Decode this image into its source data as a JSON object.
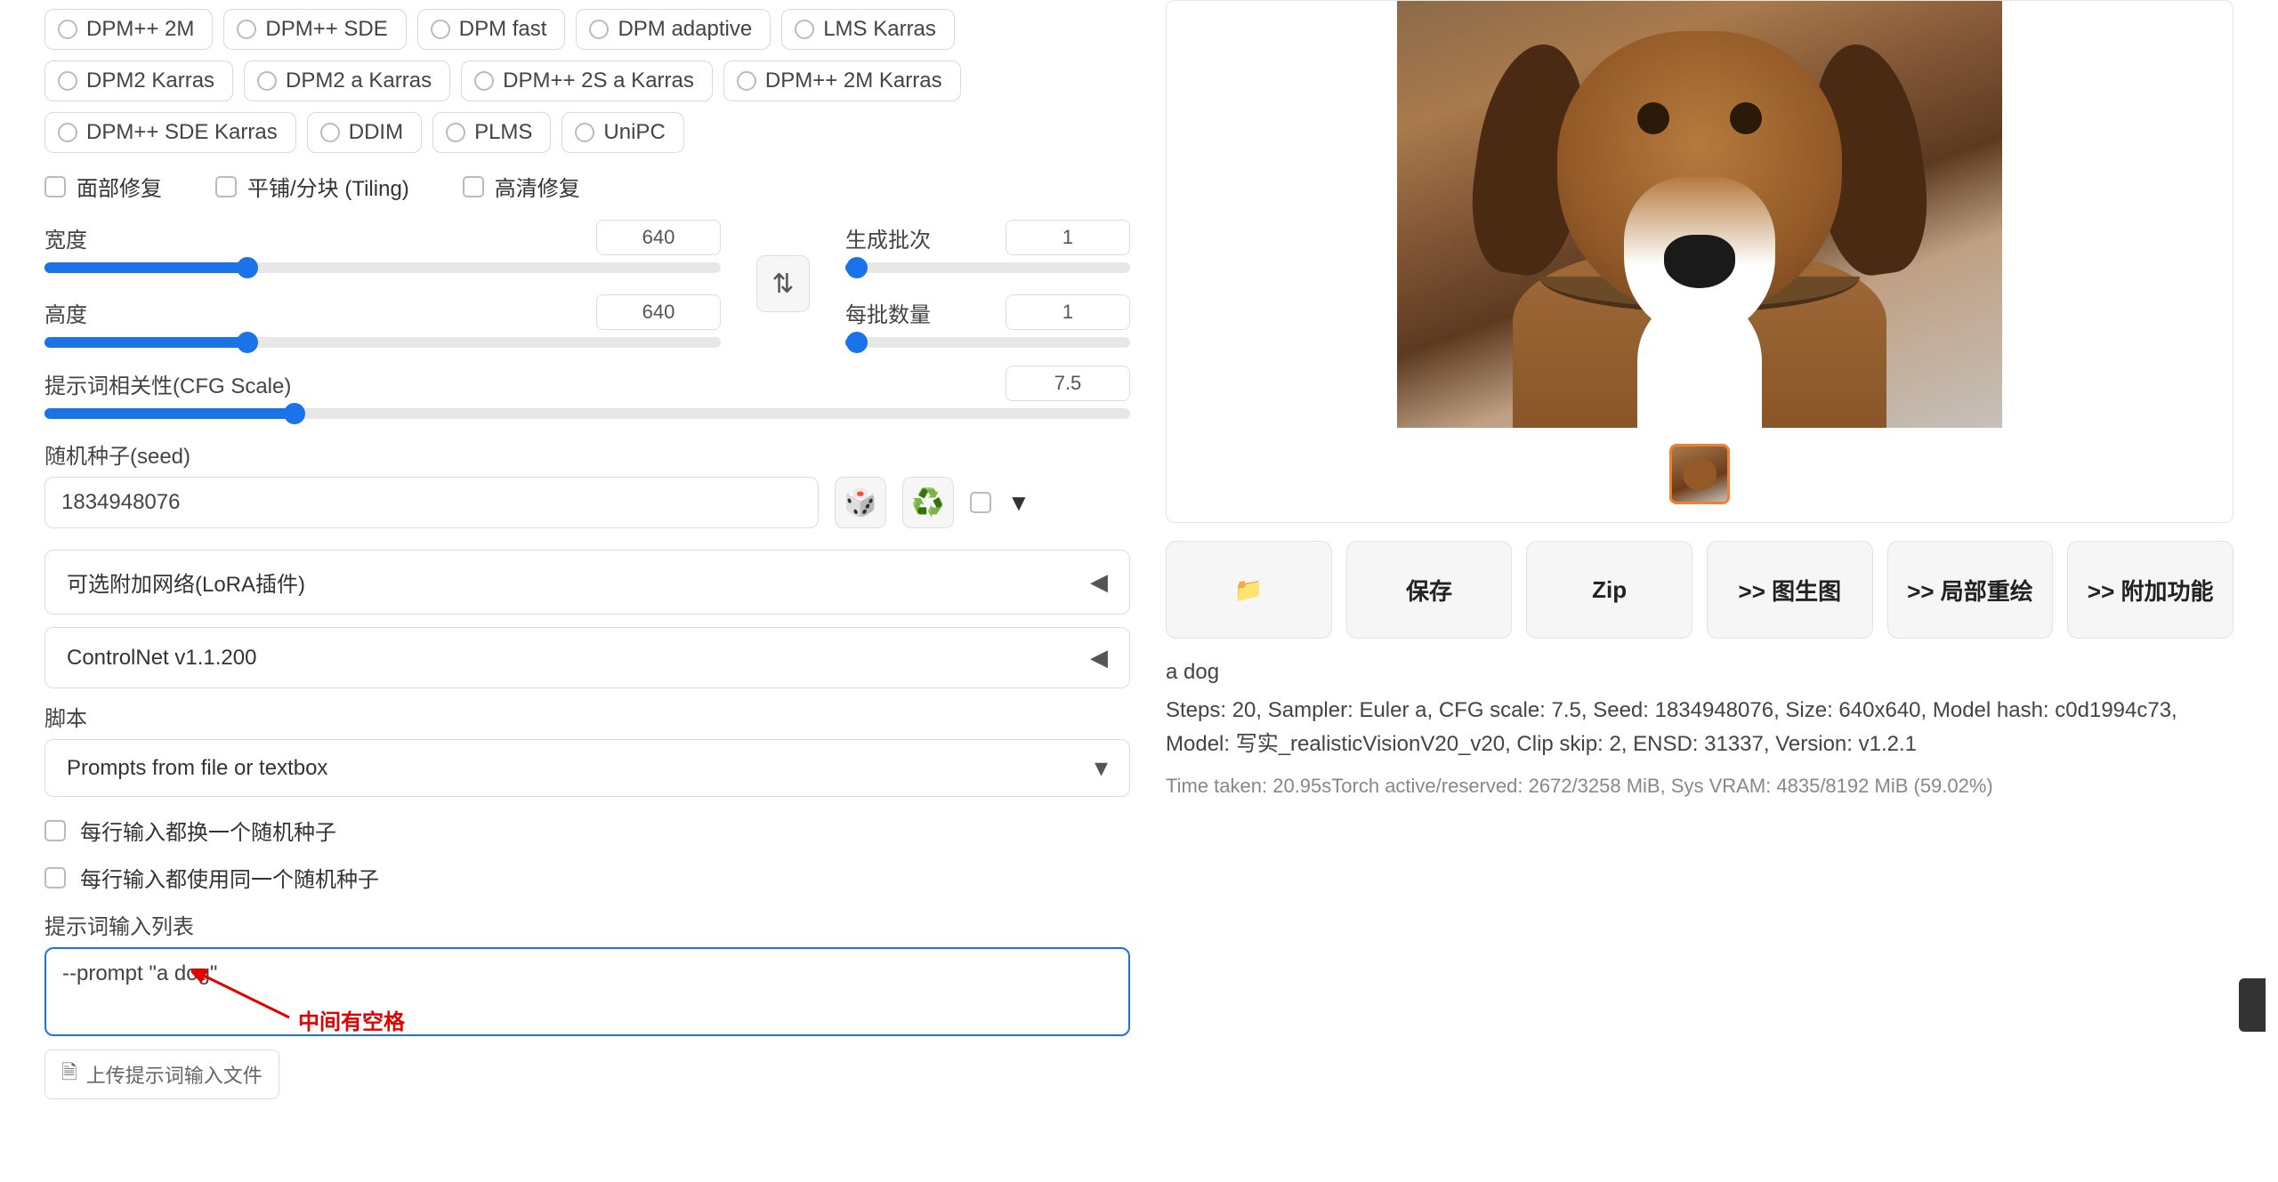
{
  "samplers": {
    "row1": [
      "DPM++ 2M",
      "DPM++ SDE",
      "DPM fast",
      "DPM adaptive",
      "LMS Karras"
    ],
    "row2": [
      "DPM2 Karras",
      "DPM2 a Karras",
      "DPM++ 2S a Karras",
      "DPM++ 2M Karras"
    ],
    "row3": [
      "DPM++ SDE Karras",
      "DDIM",
      "PLMS",
      "UniPC"
    ]
  },
  "checkboxes": {
    "face_restore": "面部修复",
    "tiling": "平铺/分块 (Tiling)",
    "hires_fix": "高清修复"
  },
  "sliders": {
    "width_label": "宽度",
    "width_value": "640",
    "width_pct": 30,
    "height_label": "高度",
    "height_value": "640",
    "height_pct": 30,
    "batch_count_label": "生成批次",
    "batch_count_value": "1",
    "batch_count_pct": 4,
    "batch_size_label": "每批数量",
    "batch_size_value": "1",
    "batch_size_pct": 4,
    "cfg_label": "提示词相关性(CFG Scale)",
    "cfg_value": "7.5",
    "cfg_pct": 23
  },
  "swap_icon": "⇅",
  "seed": {
    "label": "随机种子(seed)",
    "value": "1834948076",
    "dice": "🎲",
    "recycle": "♻️",
    "caret": "▼"
  },
  "accordions": {
    "lora": "可选附加网络(LoRA插件)",
    "controlnet": "ControlNet v1.1.200",
    "arrow": "◀"
  },
  "script": {
    "label": "脚本",
    "selected": "Prompts from file or textbox",
    "caret": "▾",
    "cb_new_seed": "每行输入都换一个随机种子",
    "cb_same_seed": "每行输入都使用同一个随机种子",
    "prompt_list_label": "提示词输入列表",
    "prompt_value": "--prompt \"a dog\"",
    "upload_label": "上传提示词输入文件",
    "file_icon": "🗎"
  },
  "annotation": {
    "text": "中间有空格"
  },
  "result": {
    "prompt": "a dog",
    "meta": "Steps: 20, Sampler: Euler a, CFG scale: 7.5, Seed: 1834948076, Size: 640x640, Model hash: c0d1994c73, Model: 写实_realisticVisionV20_v20, Clip skip: 2, ENSD: 31337, Version: v1.2.1",
    "time": "Time taken: 20.95sTorch active/reserved: 2672/3258 MiB, Sys VRAM: 4835/8192 MiB (59.02%)"
  },
  "actions": {
    "folder": "📁",
    "save": "保存",
    "zip": "Zip",
    "img2img": ">> 图生图",
    "inpaint": ">> 局部重绘",
    "extras": ">> 附加功能"
  }
}
